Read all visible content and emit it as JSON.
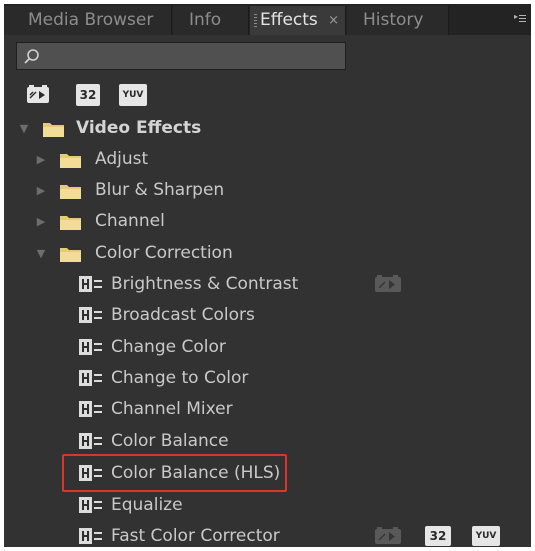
{
  "tabs": [
    {
      "label": "Media Browser",
      "active": false
    },
    {
      "label": "Info",
      "active": false
    },
    {
      "label": "Effects",
      "active": true
    },
    {
      "label": "History",
      "active": false
    }
  ],
  "tab_close_glyph": "×",
  "search": {
    "value": "",
    "placeholder": ""
  },
  "filters": {
    "accelerated": "▶",
    "bit32": "32",
    "yuv": "YUV"
  },
  "tree": {
    "video_effects": "Video Effects",
    "adjust": "Adjust",
    "blur_sharpen": "Blur & Sharpen",
    "channel": "Channel",
    "color_correction": "Color Correction",
    "effects": [
      "Brightness & Contrast",
      "Broadcast Colors",
      "Change Color",
      "Change to Color",
      "Channel Mixer",
      "Color Balance",
      "Color Balance (HLS)",
      "Equalize",
      "Fast Color Corrector"
    ]
  },
  "colors": {
    "highlight": "#d9372b",
    "panel": "#323232"
  }
}
